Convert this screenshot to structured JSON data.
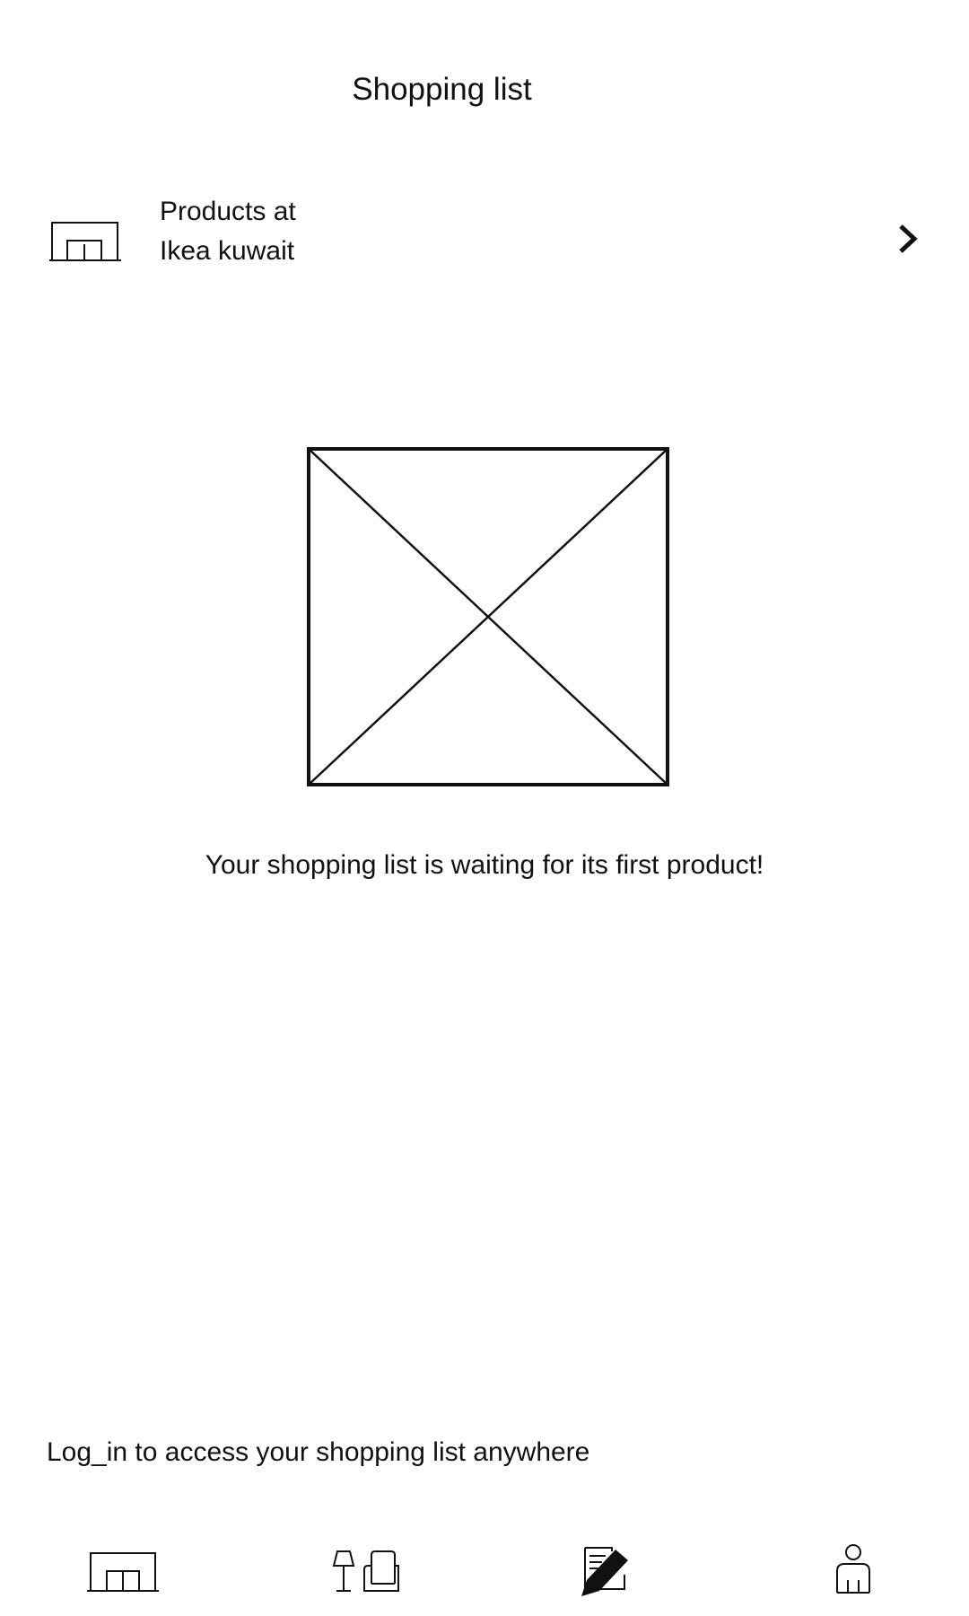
{
  "header": {
    "title": "Shopping list"
  },
  "store": {
    "line1": "Products at",
    "line2": "Ikea kuwait",
    "icon": "store-icon",
    "chevron": "chevron-right-icon"
  },
  "empty_state": {
    "image": "image-placeholder-icon",
    "message": "Your shopping list is waiting for its first product!"
  },
  "login": {
    "prompt": "Log_in to access your shopping list anywhere"
  },
  "bottom_nav": {
    "items": [
      {
        "icon": "store-icon",
        "active": false
      },
      {
        "icon": "lamp-armchair-icon",
        "active": false
      },
      {
        "icon": "shopping-list-edit-icon",
        "active": true
      },
      {
        "icon": "person-icon",
        "active": false
      }
    ]
  },
  "colors": {
    "text": "#111111",
    "background": "#ffffff"
  }
}
